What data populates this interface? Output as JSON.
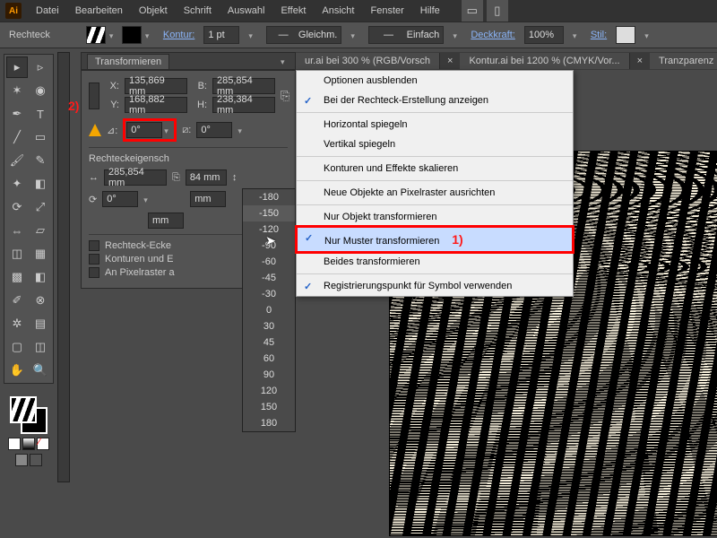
{
  "menu": [
    "Datei",
    "Bearbeiten",
    "Objekt",
    "Schrift",
    "Auswahl",
    "Effekt",
    "Ansicht",
    "Fenster",
    "Hilfe"
  ],
  "optbar": {
    "tool": "Rechteck",
    "stroke_lbl": "Kontur:",
    "stroke_val": "1 pt",
    "uniform": "Gleichm.",
    "basic": "Einfach",
    "opacity_lbl": "Deckkraft:",
    "opacity_val": "100%",
    "style_lbl": "Stil:"
  },
  "doc_tabs": [
    "ur.ai bei 300 % (RGB/Vorsch",
    "Kontur.ai bei 1200 % (CMYK/Vor...",
    "Tranzparenz"
  ],
  "panel_title": "Transformieren",
  "transform": {
    "x_lbl": "X:",
    "x": "135,869 mm",
    "y_lbl": "Y:",
    "y": "168,882 mm",
    "b_lbl": "B:",
    "b": "285,854 mm",
    "h_lbl": "H:",
    "h": "238,384 mm",
    "angle": "0°",
    "shear": "0°"
  },
  "rect_hdr": "Rechteckeigensch",
  "rect": {
    "w": "285,854 mm",
    "h_sfx": "84 mm",
    "rot": "0°",
    "corner": "mm"
  },
  "checkboxes": [
    "Rechteck-Ecke",
    "Konturen und E",
    "An Pixelraster a"
  ],
  "angle_options": [
    "-180",
    "-150",
    "-120",
    "-90",
    "-60",
    "-45",
    "-30",
    "0",
    "30",
    "45",
    "60",
    "90",
    "120",
    "150",
    "180"
  ],
  "angle_selected": "-150",
  "flyout": [
    {
      "t": "Optionen ausblenden"
    },
    {
      "t": "Bei der Rechteck-Erstellung anzeigen",
      "chk": true,
      "sep_after": true
    },
    {
      "t": "Horizontal spiegeln"
    },
    {
      "t": "Vertikal spiegeln",
      "sep_after": true
    },
    {
      "t": "Konturen und Effekte skalieren",
      "sep_after": true
    },
    {
      "t": "Neue Objekte an Pixelraster ausrichten",
      "sep_after": true
    },
    {
      "t": "Nur Objekt transformieren"
    },
    {
      "t": "Nur Muster transformieren",
      "chk": true,
      "hl": true,
      "num": "1)"
    },
    {
      "t": "Beides transformieren",
      "sep_after": true
    },
    {
      "t": "Registrierungspunkt für Symbol verwenden",
      "chk": true
    }
  ],
  "annot_2": "2)"
}
